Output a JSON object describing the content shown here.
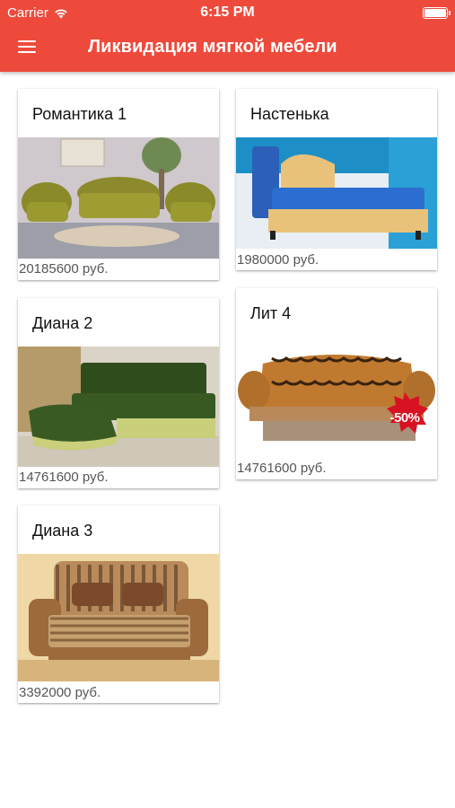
{
  "status_bar": {
    "carrier": "Carrier",
    "time": "6:15 PM"
  },
  "header": {
    "title": "Ликвидация мягкой мебели",
    "menu_icon": "hamburger-menu-icon"
  },
  "colors": {
    "header_bg": "#ee4a3c",
    "header_text": "#ffffff",
    "price_text": "#555555"
  },
  "products": [
    {
      "title": "Романтика 1",
      "price": "20185600 руб."
    },
    {
      "title": "Настенька",
      "price": "1980000 руб."
    },
    {
      "title": "Диана 2",
      "price": "14761600 руб."
    },
    {
      "title": "Лит 4",
      "price": "14761600 руб.",
      "badge": "-50%"
    },
    {
      "title": "Диана 3",
      "price": "3392000 руб."
    }
  ]
}
